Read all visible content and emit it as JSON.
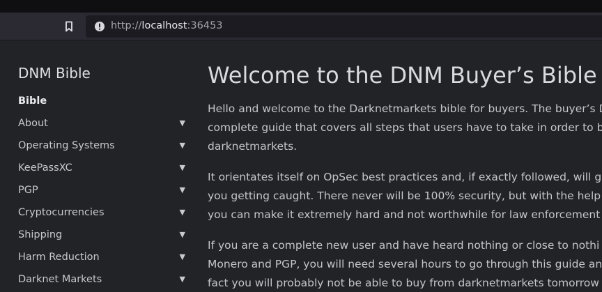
{
  "browser": {
    "url_scheme": "http://",
    "url_host": "localhost",
    "url_port": ":36453"
  },
  "sidebar": {
    "site_title": "DNM Bible",
    "items": [
      {
        "label": "Bible",
        "active": true,
        "has_caret": false
      },
      {
        "label": "About",
        "has_caret": true
      },
      {
        "label": "Operating Systems",
        "has_caret": true
      },
      {
        "label": "KeePassXC",
        "has_caret": true
      },
      {
        "label": "PGP",
        "has_caret": true
      },
      {
        "label": "Cryptocurrencies",
        "has_caret": true
      },
      {
        "label": "Shipping",
        "has_caret": true
      },
      {
        "label": "Harm Reduction",
        "has_caret": true
      },
      {
        "label": "Darknet Markets",
        "has_caret": true
      }
    ],
    "caret": "▼"
  },
  "main": {
    "heading": "Welcome to the DNM Buyer’s Bible",
    "paragraphs": [
      [
        "Hello and welcome to the Darknetmarkets bible for buyers. The buyer’s D",
        "complete guide that covers all steps that users have to take in order to b",
        "darknetmarkets."
      ],
      [
        "It orientates itself on OpSec best practices and, if exactly followed, will g",
        "you getting caught. There never will be 100% security, but with the help o",
        "you can make it extremely hard and not worthwhile for law enforcement"
      ],
      [
        "If you are a complete new user and have heard nothing or close to nothi",
        "Monero and PGP, you will need several hours to go through this guide an",
        "fact you will probably not be able to buy from darknetmarkets tomorrow"
      ]
    ]
  }
}
